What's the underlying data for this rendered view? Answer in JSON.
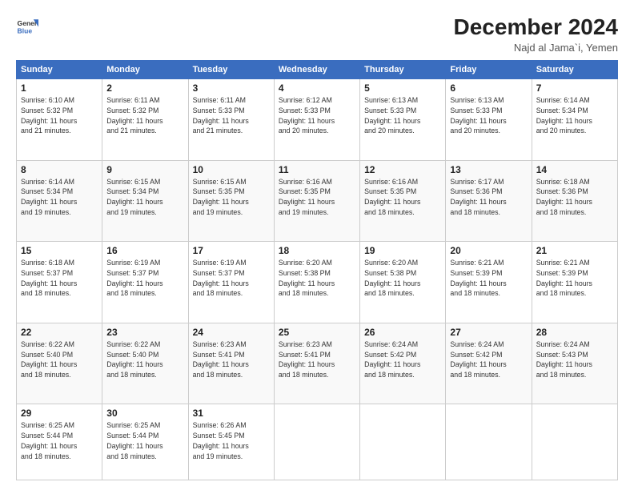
{
  "header": {
    "logo_line1": "General",
    "logo_line2": "Blue",
    "title": "December 2024",
    "subtitle": "Najd al Jama`i, Yemen"
  },
  "calendar": {
    "days_of_week": [
      "Sunday",
      "Monday",
      "Tuesday",
      "Wednesday",
      "Thursday",
      "Friday",
      "Saturday"
    ],
    "weeks": [
      [
        {
          "day": "1",
          "info": "Sunrise: 6:10 AM\nSunset: 5:32 PM\nDaylight: 11 hours\nand 21 minutes."
        },
        {
          "day": "2",
          "info": "Sunrise: 6:11 AM\nSunset: 5:32 PM\nDaylight: 11 hours\nand 21 minutes."
        },
        {
          "day": "3",
          "info": "Sunrise: 6:11 AM\nSunset: 5:33 PM\nDaylight: 11 hours\nand 21 minutes."
        },
        {
          "day": "4",
          "info": "Sunrise: 6:12 AM\nSunset: 5:33 PM\nDaylight: 11 hours\nand 20 minutes."
        },
        {
          "day": "5",
          "info": "Sunrise: 6:13 AM\nSunset: 5:33 PM\nDaylight: 11 hours\nand 20 minutes."
        },
        {
          "day": "6",
          "info": "Sunrise: 6:13 AM\nSunset: 5:33 PM\nDaylight: 11 hours\nand 20 minutes."
        },
        {
          "day": "7",
          "info": "Sunrise: 6:14 AM\nSunset: 5:34 PM\nDaylight: 11 hours\nand 20 minutes."
        }
      ],
      [
        {
          "day": "8",
          "info": "Sunrise: 6:14 AM\nSunset: 5:34 PM\nDaylight: 11 hours\nand 19 minutes."
        },
        {
          "day": "9",
          "info": "Sunrise: 6:15 AM\nSunset: 5:34 PM\nDaylight: 11 hours\nand 19 minutes."
        },
        {
          "day": "10",
          "info": "Sunrise: 6:15 AM\nSunset: 5:35 PM\nDaylight: 11 hours\nand 19 minutes."
        },
        {
          "day": "11",
          "info": "Sunrise: 6:16 AM\nSunset: 5:35 PM\nDaylight: 11 hours\nand 19 minutes."
        },
        {
          "day": "12",
          "info": "Sunrise: 6:16 AM\nSunset: 5:35 PM\nDaylight: 11 hours\nand 18 minutes."
        },
        {
          "day": "13",
          "info": "Sunrise: 6:17 AM\nSunset: 5:36 PM\nDaylight: 11 hours\nand 18 minutes."
        },
        {
          "day": "14",
          "info": "Sunrise: 6:18 AM\nSunset: 5:36 PM\nDaylight: 11 hours\nand 18 minutes."
        }
      ],
      [
        {
          "day": "15",
          "info": "Sunrise: 6:18 AM\nSunset: 5:37 PM\nDaylight: 11 hours\nand 18 minutes."
        },
        {
          "day": "16",
          "info": "Sunrise: 6:19 AM\nSunset: 5:37 PM\nDaylight: 11 hours\nand 18 minutes."
        },
        {
          "day": "17",
          "info": "Sunrise: 6:19 AM\nSunset: 5:37 PM\nDaylight: 11 hours\nand 18 minutes."
        },
        {
          "day": "18",
          "info": "Sunrise: 6:20 AM\nSunset: 5:38 PM\nDaylight: 11 hours\nand 18 minutes."
        },
        {
          "day": "19",
          "info": "Sunrise: 6:20 AM\nSunset: 5:38 PM\nDaylight: 11 hours\nand 18 minutes."
        },
        {
          "day": "20",
          "info": "Sunrise: 6:21 AM\nSunset: 5:39 PM\nDaylight: 11 hours\nand 18 minutes."
        },
        {
          "day": "21",
          "info": "Sunrise: 6:21 AM\nSunset: 5:39 PM\nDaylight: 11 hours\nand 18 minutes."
        }
      ],
      [
        {
          "day": "22",
          "info": "Sunrise: 6:22 AM\nSunset: 5:40 PM\nDaylight: 11 hours\nand 18 minutes."
        },
        {
          "day": "23",
          "info": "Sunrise: 6:22 AM\nSunset: 5:40 PM\nDaylight: 11 hours\nand 18 minutes."
        },
        {
          "day": "24",
          "info": "Sunrise: 6:23 AM\nSunset: 5:41 PM\nDaylight: 11 hours\nand 18 minutes."
        },
        {
          "day": "25",
          "info": "Sunrise: 6:23 AM\nSunset: 5:41 PM\nDaylight: 11 hours\nand 18 minutes."
        },
        {
          "day": "26",
          "info": "Sunrise: 6:24 AM\nSunset: 5:42 PM\nDaylight: 11 hours\nand 18 minutes."
        },
        {
          "day": "27",
          "info": "Sunrise: 6:24 AM\nSunset: 5:42 PM\nDaylight: 11 hours\nand 18 minutes."
        },
        {
          "day": "28",
          "info": "Sunrise: 6:24 AM\nSunset: 5:43 PM\nDaylight: 11 hours\nand 18 minutes."
        }
      ],
      [
        {
          "day": "29",
          "info": "Sunrise: 6:25 AM\nSunset: 5:44 PM\nDaylight: 11 hours\nand 18 minutes."
        },
        {
          "day": "30",
          "info": "Sunrise: 6:25 AM\nSunset: 5:44 PM\nDaylight: 11 hours\nand 18 minutes."
        },
        {
          "day": "31",
          "info": "Sunrise: 6:26 AM\nSunset: 5:45 PM\nDaylight: 11 hours\nand 19 minutes."
        },
        {
          "day": "",
          "info": ""
        },
        {
          "day": "",
          "info": ""
        },
        {
          "day": "",
          "info": ""
        },
        {
          "day": "",
          "info": ""
        }
      ]
    ]
  }
}
